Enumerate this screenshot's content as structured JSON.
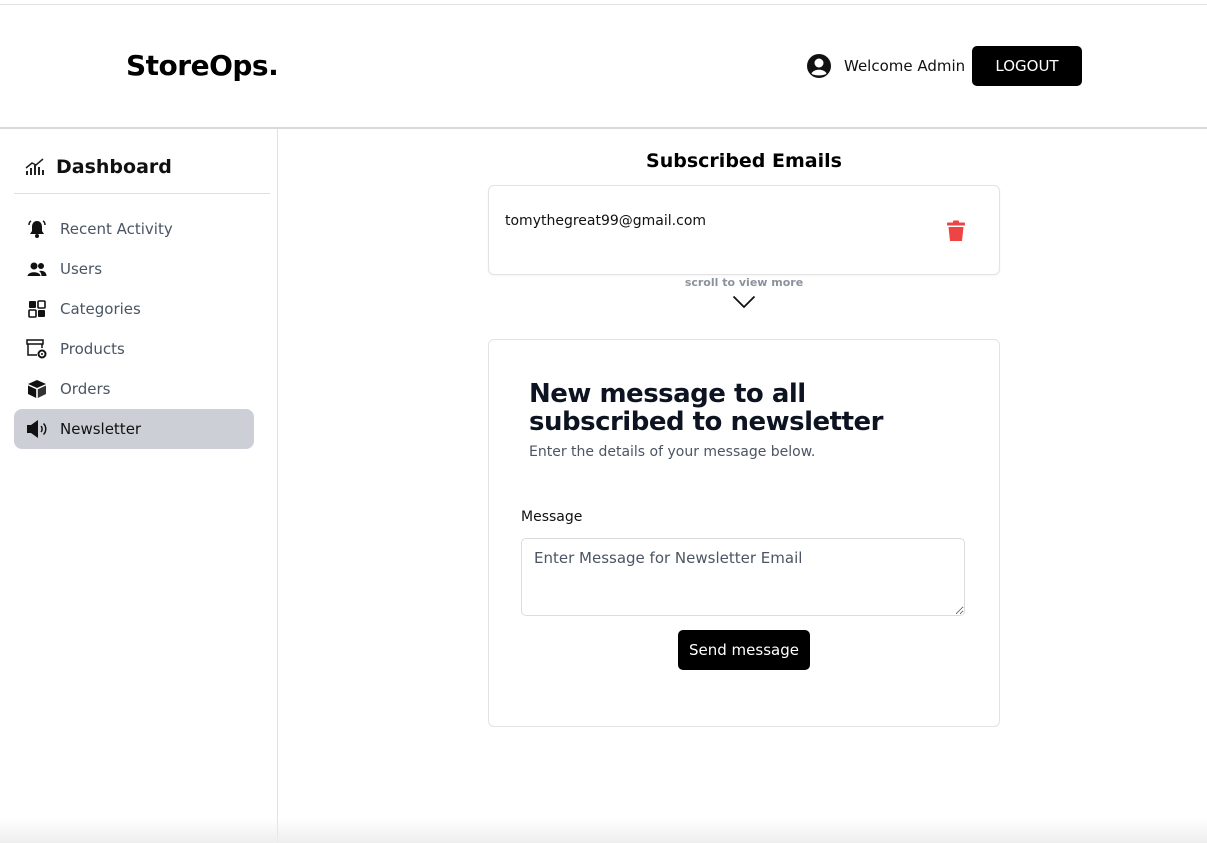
{
  "header": {
    "logo": "StoreOps.",
    "welcome_text": "Welcome Admin",
    "logout_label": "LOGOUT"
  },
  "sidebar": {
    "title": "Dashboard",
    "title_icon": "chart-bars-icon",
    "items": [
      {
        "label": "Recent Activity",
        "icon": "bell-icon",
        "active": false
      },
      {
        "label": "Users",
        "icon": "users-icon",
        "active": false
      },
      {
        "label": "Categories",
        "icon": "categories-icon",
        "active": false
      },
      {
        "label": "Products",
        "icon": "products-icon",
        "active": false
      },
      {
        "label": "Orders",
        "icon": "box-icon",
        "active": false
      },
      {
        "label": "Newsletter",
        "icon": "megaphone-icon",
        "active": true
      }
    ]
  },
  "main": {
    "title": "Subscribed Emails",
    "emails": [
      "tomythegreat99@gmail.com"
    ],
    "scroll_hint": "scroll to view more",
    "form": {
      "title": "New message to all subscribed to newsletter",
      "subtitle": "Enter the details of your message below.",
      "message_label": "Message",
      "message_placeholder": "Enter Message for Newsletter Email",
      "message_value": "",
      "send_label": "Send message"
    }
  },
  "colors": {
    "accent": "#000000",
    "active_nav_bg": "#ccd0d6",
    "delete_icon": "#ef4444",
    "muted_text": "#4b5563"
  }
}
